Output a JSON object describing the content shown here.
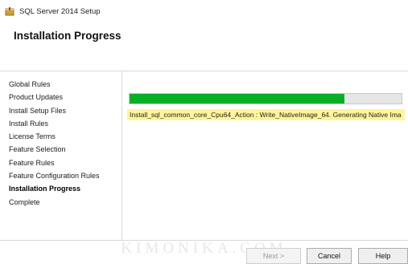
{
  "window": {
    "title": "SQL Server 2014 Setup",
    "icon": "sql-setup-box-icon"
  },
  "header": {
    "title": "Installation Progress"
  },
  "sidebar": {
    "items": [
      {
        "label": "Global Rules",
        "current": false
      },
      {
        "label": "Product Updates",
        "current": false
      },
      {
        "label": "Install Setup Files",
        "current": false
      },
      {
        "label": "Install Rules",
        "current": false
      },
      {
        "label": "License Terms",
        "current": false
      },
      {
        "label": "Feature Selection",
        "current": false
      },
      {
        "label": "Feature Rules",
        "current": false
      },
      {
        "label": "Feature Configuration Rules",
        "current": false
      },
      {
        "label": "Installation Progress",
        "current": true
      },
      {
        "label": "Complete",
        "current": false
      }
    ]
  },
  "progress": {
    "value_percent": 79,
    "fill_color": "#06b025",
    "status_text": "Install_sql_common_core_Cpu64_Action : Write_NativeImage_64. Generating Native Ima",
    "status_highlight_color": "#fff59a"
  },
  "buttons": {
    "next": {
      "label": "Next >",
      "enabled": false
    },
    "cancel": {
      "label": "Cancel",
      "enabled": true
    },
    "help": {
      "label": "Help",
      "enabled": true
    }
  },
  "watermark": {
    "text": "KIMONIKA.COM"
  }
}
